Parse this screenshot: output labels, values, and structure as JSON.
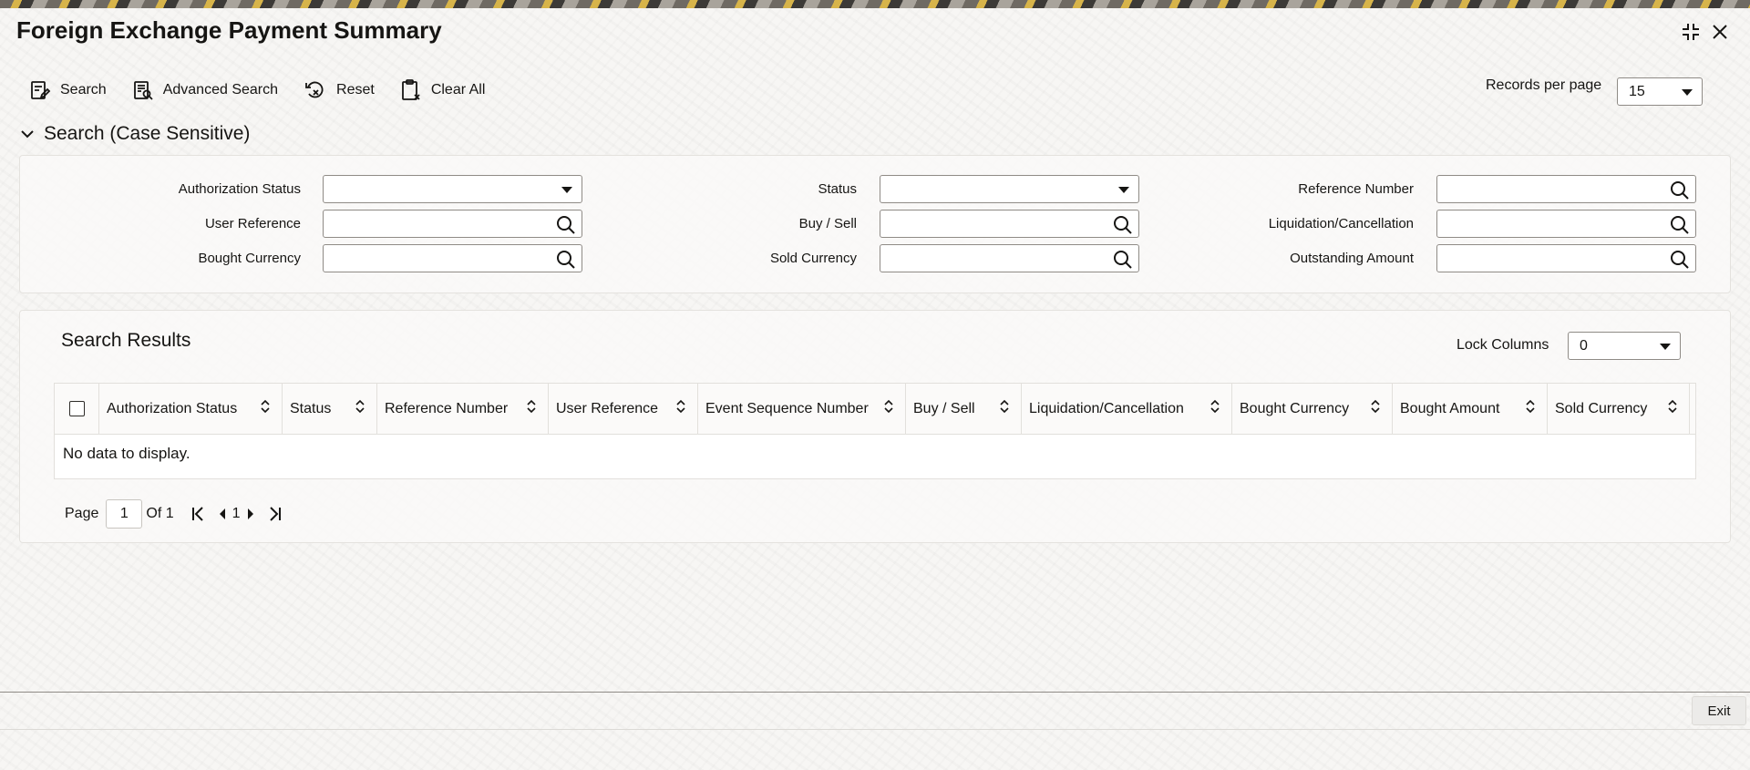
{
  "window": {
    "title": "Foreign Exchange Payment Summary"
  },
  "toolbar": {
    "search_label": "Search",
    "advanced_search_label": "Advanced Search",
    "reset_label": "Reset",
    "clear_all_label": "Clear All",
    "records_per_page_label": "Records per page",
    "records_per_page_value": "15"
  },
  "search_section": {
    "heading": "Search (Case Sensitive)",
    "fields": {
      "authorization_status": {
        "label": "Authorization Status",
        "value": ""
      },
      "status": {
        "label": "Status",
        "value": ""
      },
      "reference_number": {
        "label": "Reference Number",
        "value": ""
      },
      "user_reference": {
        "label": "User Reference",
        "value": ""
      },
      "buy_sell": {
        "label": "Buy / Sell",
        "value": ""
      },
      "liquidation_cancellation": {
        "label": "Liquidation/Cancellation",
        "value": ""
      },
      "bought_currency": {
        "label": "Bought Currency",
        "value": ""
      },
      "sold_currency": {
        "label": "Sold Currency",
        "value": ""
      },
      "outstanding_amount": {
        "label": "Outstanding Amount",
        "value": ""
      }
    }
  },
  "results": {
    "title": "Search Results",
    "lock_columns_label": "Lock Columns",
    "lock_columns_value": "0",
    "columns": [
      "Authorization Status",
      "Status",
      "Reference Number",
      "User Reference",
      "Event Sequence Number",
      "Buy / Sell",
      "Liquidation/Cancellation",
      "Bought Currency",
      "Bought Amount",
      "Sold Currency"
    ],
    "empty_message": "No data to display."
  },
  "pagination": {
    "page_label": "Page",
    "current_page": "1",
    "of_label": "Of 1",
    "page_number": "1"
  },
  "footer": {
    "exit_label": "Exit"
  }
}
